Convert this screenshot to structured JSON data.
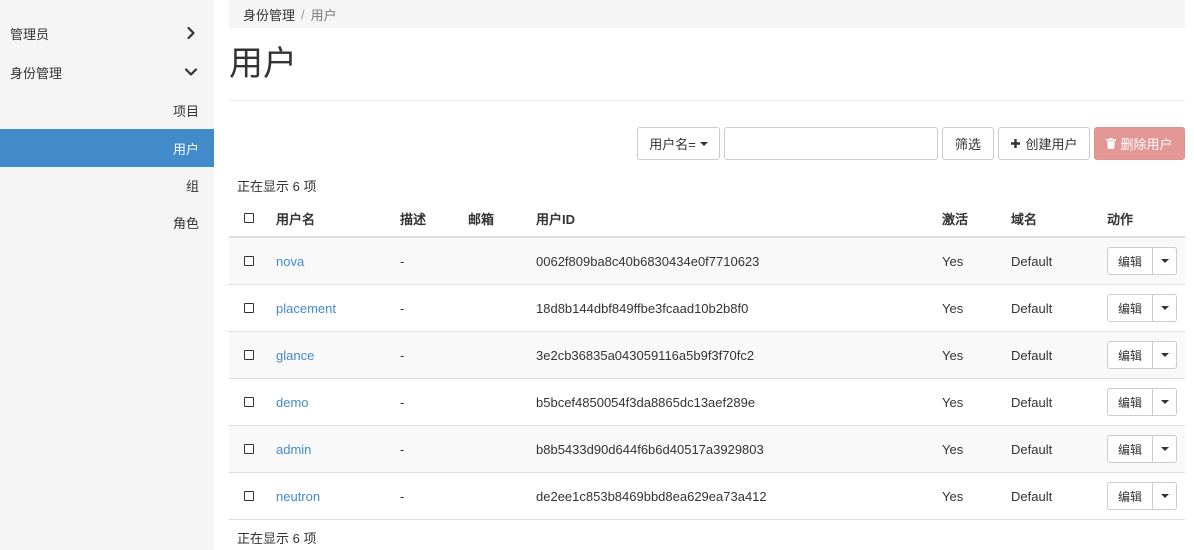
{
  "sidebar": {
    "admin": "管理员",
    "identity": "身份管理",
    "items": [
      "项目",
      "用户",
      "组",
      "角色"
    ],
    "active_index": 1
  },
  "breadcrumb": {
    "parent": "身份管理",
    "separator": "/",
    "current": "用户"
  },
  "page": {
    "title": "用户"
  },
  "toolbar": {
    "filter_field": "用户名=",
    "filter_value": "",
    "filter_button": "筛选",
    "create_button": "创建用户",
    "delete_button": "删除用户"
  },
  "count_text": "正在显示 6 项",
  "table": {
    "headers": [
      "用户名",
      "描述",
      "邮箱",
      "用户ID",
      "激活",
      "域名",
      "动作"
    ],
    "rows": [
      {
        "name": "nova",
        "description": "-",
        "email": "",
        "id": "0062f809ba8c40b6830434e0f7710623",
        "enabled": "Yes",
        "domain": "Default",
        "action": "编辑"
      },
      {
        "name": "placement",
        "description": "-",
        "email": "",
        "id": "18d8b144dbf849ffbe3fcaad10b2b8f0",
        "enabled": "Yes",
        "domain": "Default",
        "action": "编辑"
      },
      {
        "name": "glance",
        "description": "-",
        "email": "",
        "id": "3e2cb36835a043059116a5b9f3f70fc2",
        "enabled": "Yes",
        "domain": "Default",
        "action": "编辑"
      },
      {
        "name": "demo",
        "description": "-",
        "email": "",
        "id": "b5bcef4850054f3da8865dc13aef289e",
        "enabled": "Yes",
        "domain": "Default",
        "action": "编辑"
      },
      {
        "name": "admin",
        "description": "-",
        "email": "",
        "id": "b8b5433d90d644f6b6d40517a3929803",
        "enabled": "Yes",
        "domain": "Default",
        "action": "编辑"
      },
      {
        "name": "neutron",
        "description": "-",
        "email": "",
        "id": "de2ee1c853b8469bbd8ea629ea73a412",
        "enabled": "Yes",
        "domain": "Default",
        "action": "编辑"
      }
    ]
  },
  "icons": {
    "collapsed": "chevron-right-icon",
    "expanded": "chevron-down-icon",
    "create": "plus-icon",
    "delete": "trash-icon",
    "dropdown": "caret-down-icon"
  },
  "colors": {
    "link": "#428bca",
    "active": "#428bca",
    "danger": "#e49895"
  }
}
